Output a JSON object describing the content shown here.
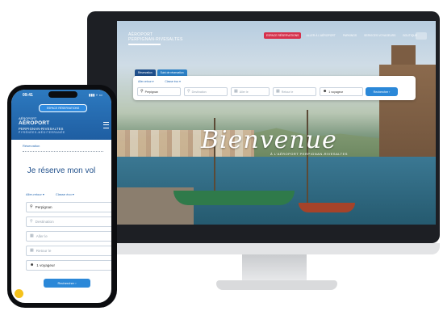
{
  "desktop": {
    "logo": {
      "line1": "AÉROPORT",
      "line2": "PERPIGNAN-RIVESALTES"
    },
    "nav": [
      {
        "label": "ESPACE RÉSERVATIONS",
        "style": "primary"
      },
      {
        "label": "ALLER À L'AÉROPORT",
        "style": "plain"
      },
      {
        "label": "PARKINGS",
        "style": "plain"
      },
      {
        "label": "SERVICES VOYAGEURS",
        "style": "plain"
      },
      {
        "label": "BOUTIQUE",
        "style": "plain"
      }
    ],
    "search": {
      "tabs": [
        "Réservation",
        "Suivi de réservation"
      ],
      "trip_type": "Aller-retour ▾",
      "class": "Classe éco ▾",
      "from_value": "Perpignan",
      "to_placeholder": "Destination",
      "depart_placeholder": "Aller le",
      "return_placeholder": "Retour le",
      "passengers_value": "1 voyageur",
      "button": "Rechercher ›"
    },
    "hero": {
      "title": "Bienvenue",
      "subtitle": "À L'AÉROPORT PERPIGNAN-RIVESALTES"
    }
  },
  "mobile": {
    "status_time": "09:41",
    "status_icons": "▮▮▮ ◗ ▭",
    "pill": "ESPACE RÉSERVATIONS",
    "logo": {
      "small": "AÉROPORT",
      "main": "AÉROPORT",
      "sub": "PERPIGNAN-RIVESALTES",
      "tag": "PYRÉNÉES-MÉDITERRANÉE"
    },
    "section_label": "Réservation",
    "title": "Je réserve mon vol",
    "trip_type": "Aller-retour ▾",
    "class": "Classe éco ▾",
    "fields": [
      {
        "icon": "location-pin-icon",
        "text": "Perpignan",
        "filled": true
      },
      {
        "icon": "location-pin-icon",
        "text": "Destination",
        "filled": false
      },
      {
        "icon": "calendar-icon",
        "text": "Aller le",
        "filled": false
      },
      {
        "icon": "calendar-icon",
        "text": "Retour le",
        "filled": false
      },
      {
        "icon": "users-icon",
        "text": "1 voyageur",
        "filled": true
      }
    ],
    "button": "Rechercher ›"
  },
  "colors": {
    "brand_blue": "#2b88d8",
    "brand_dark": "#1f4f8b",
    "accent_red": "#d6314c",
    "help_yellow": "#f5c21b"
  }
}
